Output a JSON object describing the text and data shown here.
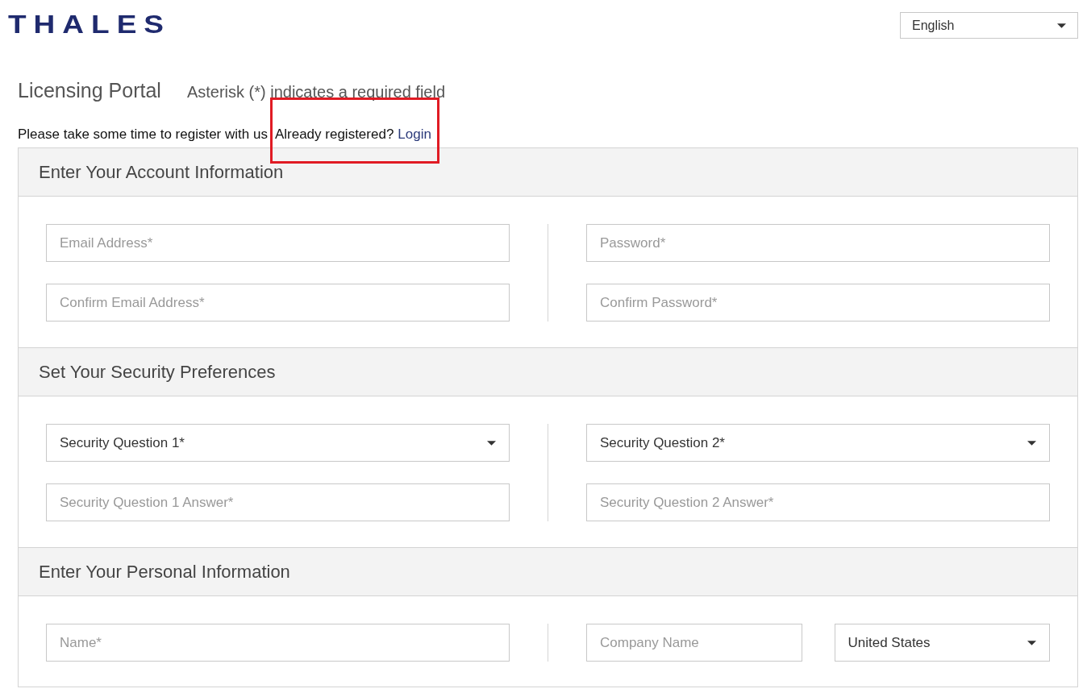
{
  "logo": {
    "text": "THALES"
  },
  "language": {
    "value": "English"
  },
  "heading": {
    "title": "Licensing Portal",
    "note": "Asterisk (*) indicates a required field"
  },
  "intro": {
    "text": "Please take some time to register with us",
    "prompt": "Already registered?",
    "link": "Login",
    "highlighted": true
  },
  "sections": [
    {
      "title": "Enter Your Account Information",
      "columns": [
        [
          [
            {
              "kind": "input",
              "placeholder": "Email Address*"
            }
          ],
          [
            {
              "kind": "input",
              "placeholder": "Confirm Email Address*"
            }
          ]
        ],
        [
          [
            {
              "kind": "input",
              "placeholder": "Password*"
            }
          ],
          [
            {
              "kind": "input",
              "placeholder": "Confirm Password*"
            }
          ]
        ]
      ]
    },
    {
      "title": "Set Your Security Preferences",
      "columns": [
        [
          [
            {
              "kind": "select",
              "value": "Security Question 1*"
            }
          ],
          [
            {
              "kind": "input",
              "placeholder": "Security Question 1 Answer*"
            }
          ]
        ],
        [
          [
            {
              "kind": "select",
              "value": "Security Question 2*"
            }
          ],
          [
            {
              "kind": "input",
              "placeholder": "Security Question 2 Answer*"
            }
          ]
        ]
      ]
    },
    {
      "title": "Enter Your Personal Information",
      "columns": [
        [
          [
            {
              "kind": "input",
              "placeholder": "Name*"
            }
          ]
        ],
        [
          [
            {
              "kind": "input",
              "placeholder": "Company Name"
            },
            {
              "kind": "select",
              "value": "United States"
            }
          ]
        ]
      ]
    }
  ]
}
